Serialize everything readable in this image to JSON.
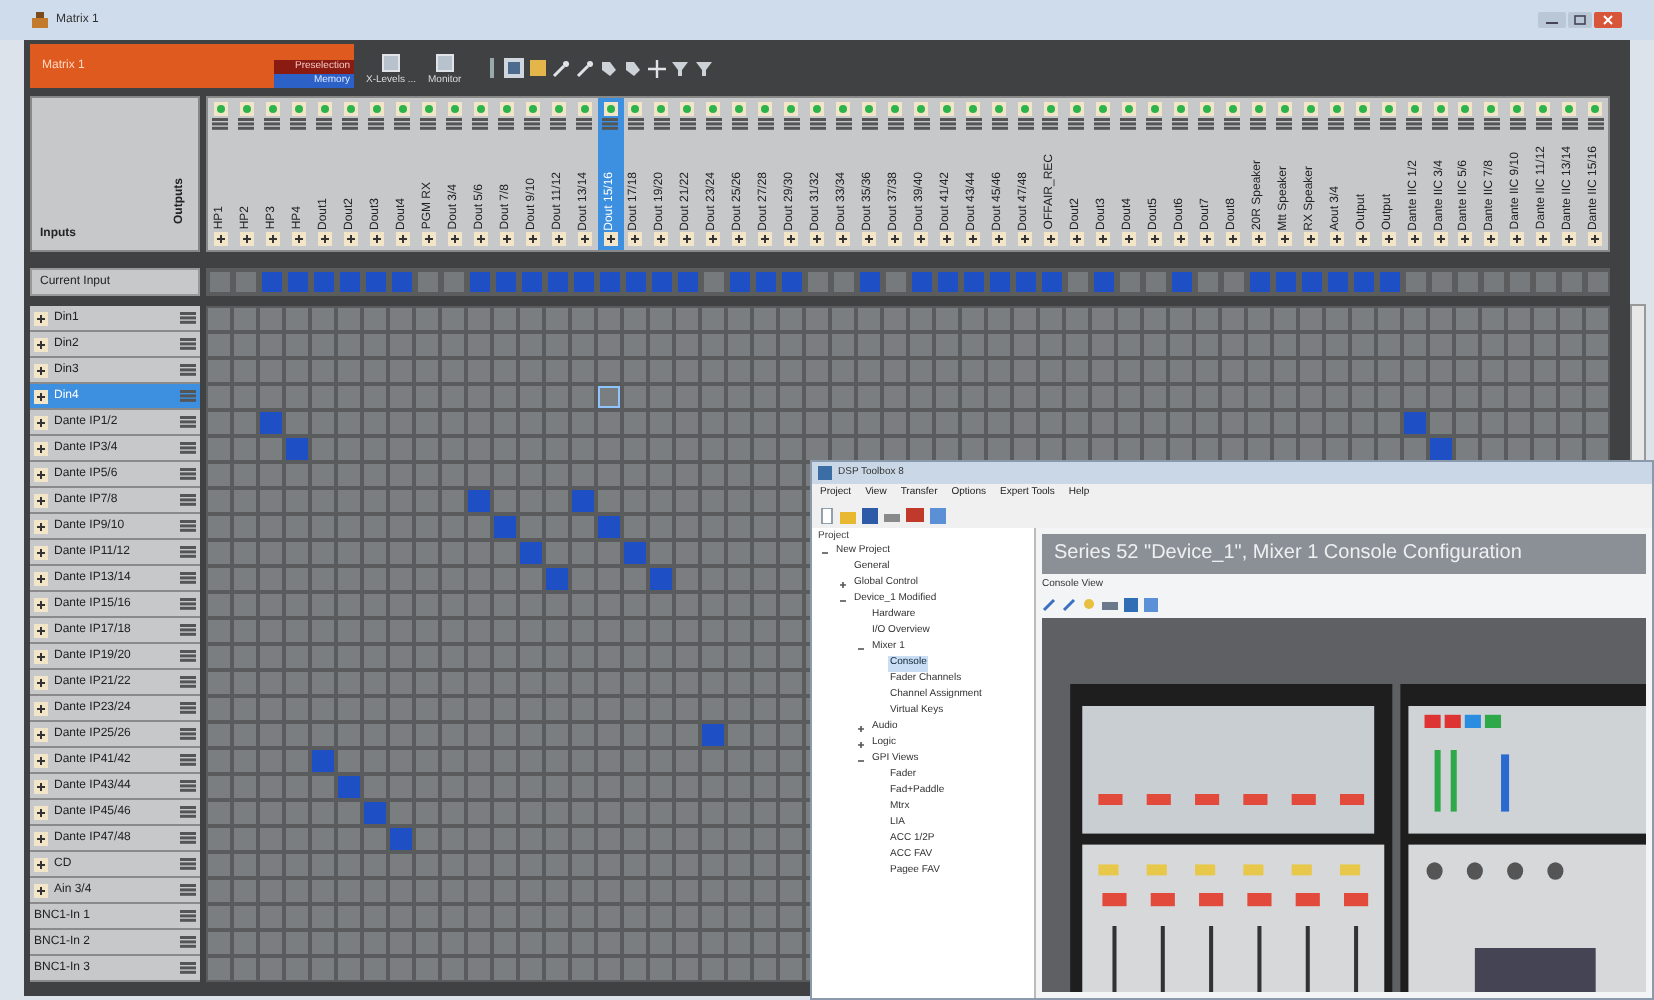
{
  "window": {
    "title": "Matrix 1"
  },
  "header": {
    "name": "Matrix 1",
    "preselection": "Preselection",
    "memory": "Memory",
    "tools": [
      {
        "label": "X-Levels ..."
      },
      {
        "label": "Monitor"
      }
    ]
  },
  "corner": {
    "outputs_label": "Outputs",
    "inputs_label": "Inputs"
  },
  "current_input_label": "Current Input",
  "outputs": [
    {
      "label": "HP1",
      "selected": false,
      "current": false
    },
    {
      "label": "HP2",
      "selected": false,
      "current": false
    },
    {
      "label": "HP3",
      "selected": false,
      "current": true
    },
    {
      "label": "HP4",
      "selected": false,
      "current": true
    },
    {
      "label": "Dout1",
      "selected": false,
      "current": true
    },
    {
      "label": "Dout2",
      "selected": false,
      "current": true
    },
    {
      "label": "Dout3",
      "selected": false,
      "current": true
    },
    {
      "label": "Dout4",
      "selected": false,
      "current": true
    },
    {
      "label": "PGM RX",
      "selected": false,
      "current": false
    },
    {
      "label": "Dout 3/4",
      "selected": false,
      "current": false
    },
    {
      "label": "Dout 5/6",
      "selected": false,
      "current": true
    },
    {
      "label": "Dout 7/8",
      "selected": false,
      "current": true
    },
    {
      "label": "Dout 9/10",
      "selected": false,
      "current": true
    },
    {
      "label": "Dout 11/12",
      "selected": false,
      "current": true
    },
    {
      "label": "Dout 13/14",
      "selected": false,
      "current": true
    },
    {
      "label": "Dout 15/16",
      "selected": true,
      "current": true
    },
    {
      "label": "Dout 17/18",
      "selected": false,
      "current": true
    },
    {
      "label": "Dout 19/20",
      "selected": false,
      "current": true
    },
    {
      "label": "Dout 21/22",
      "selected": false,
      "current": true
    },
    {
      "label": "Dout 23/24",
      "selected": false,
      "current": false
    },
    {
      "label": "Dout 25/26",
      "selected": false,
      "current": true
    },
    {
      "label": "Dout 27/28",
      "selected": false,
      "current": true
    },
    {
      "label": "Dout 29/30",
      "selected": false,
      "current": true
    },
    {
      "label": "Dout 31/32",
      "selected": false,
      "current": false
    },
    {
      "label": "Dout 33/34",
      "selected": false,
      "current": false
    },
    {
      "label": "Dout 35/36",
      "selected": false,
      "current": true
    },
    {
      "label": "Dout 37/38",
      "selected": false,
      "current": false
    },
    {
      "label": "Dout 39/40",
      "selected": false,
      "current": true
    },
    {
      "label": "Dout 41/42",
      "selected": false,
      "current": true
    },
    {
      "label": "Dout 43/44",
      "selected": false,
      "current": true
    },
    {
      "label": "Dout 45/46",
      "selected": false,
      "current": true
    },
    {
      "label": "Dout 47/48",
      "selected": false,
      "current": true
    },
    {
      "label": "OFFAIR_REC",
      "selected": false,
      "current": true
    },
    {
      "label": "Dout2",
      "selected": false,
      "current": false
    },
    {
      "label": "Dout3",
      "selected": false,
      "current": true
    },
    {
      "label": "Dout4",
      "selected": false,
      "current": false
    },
    {
      "label": "Dout5",
      "selected": false,
      "current": false
    },
    {
      "label": "Dout6",
      "selected": false,
      "current": true
    },
    {
      "label": "Dout7",
      "selected": false,
      "current": false
    },
    {
      "label": "Dout8",
      "selected": false,
      "current": false
    },
    {
      "label": "20R Speaker",
      "selected": false,
      "current": true
    },
    {
      "label": "Mtt Speaker",
      "selected": false,
      "current": true
    },
    {
      "label": "RX Speaker",
      "selected": false,
      "current": true
    },
    {
      "label": "Aout 3/4",
      "selected": false,
      "current": true
    },
    {
      "label": "Output",
      "selected": false,
      "current": true
    },
    {
      "label": "Output",
      "selected": false,
      "current": true
    },
    {
      "label": "Dante IIC 1/2",
      "selected": false,
      "current": false
    },
    {
      "label": "Dante IIC 3/4",
      "selected": false,
      "current": false
    },
    {
      "label": "Dante IIC 5/6",
      "selected": false,
      "current": false
    },
    {
      "label": "Dante IIC 7/8",
      "selected": false,
      "current": false
    },
    {
      "label": "Dante IIC 9/10",
      "selected": false,
      "current": false
    },
    {
      "label": "Dante IIC 11/12",
      "selected": false,
      "current": false
    },
    {
      "label": "Dante IIC 13/14",
      "selected": false,
      "current": false
    },
    {
      "label": "Dante IIC 15/16",
      "selected": false,
      "current": false
    }
  ],
  "inputs": [
    {
      "label": "Din1",
      "expandable": true,
      "selected": false,
      "routes": [
        false,
        false,
        false,
        false,
        false,
        false,
        false,
        false,
        false,
        false,
        false,
        false,
        false,
        false,
        false,
        false,
        false,
        false,
        false,
        false,
        false,
        false,
        false,
        false,
        false,
        false,
        false,
        false,
        false,
        false,
        false,
        false,
        false,
        false,
        false,
        false,
        false,
        false,
        false,
        false,
        false,
        false,
        false,
        false,
        false,
        false,
        false,
        false,
        false,
        false,
        false,
        false,
        false,
        false
      ]
    },
    {
      "label": "Din2",
      "expandable": true,
      "selected": false,
      "routes": [
        false,
        false,
        false,
        false,
        false,
        false,
        false,
        false,
        false,
        false,
        false,
        false,
        false,
        false,
        false,
        false,
        false,
        false,
        false,
        false,
        false,
        false,
        false,
        false,
        false,
        false,
        false,
        false,
        false,
        false,
        false,
        false,
        false,
        false,
        false,
        false,
        false,
        false,
        false,
        false,
        false,
        false,
        false,
        false,
        false,
        false,
        false,
        false,
        false,
        false,
        false,
        false,
        false,
        false
      ]
    },
    {
      "label": "Din3",
      "expandable": true,
      "selected": false,
      "routes": [
        false,
        false,
        false,
        false,
        false,
        false,
        false,
        false,
        false,
        false,
        false,
        false,
        false,
        false,
        false,
        false,
        false,
        false,
        false,
        false,
        false,
        false,
        false,
        false,
        false,
        false,
        false,
        false,
        false,
        false,
        false,
        false,
        false,
        false,
        false,
        false,
        false,
        false,
        false,
        false,
        false,
        false,
        false,
        false,
        false,
        false,
        false,
        false,
        false,
        false,
        false,
        false,
        false,
        false
      ]
    },
    {
      "label": "Din4",
      "expandable": true,
      "selected": true,
      "routes": [
        false,
        false,
        false,
        false,
        false,
        false,
        false,
        false,
        false,
        false,
        false,
        false,
        false,
        false,
        false,
        false,
        false,
        false,
        false,
        false,
        false,
        false,
        false,
        false,
        false,
        false,
        false,
        false,
        false,
        false,
        false,
        false,
        false,
        false,
        false,
        false,
        false,
        false,
        false,
        false,
        false,
        false,
        false,
        false,
        false,
        false,
        false,
        false,
        false,
        false,
        false,
        false,
        false,
        false
      ]
    },
    {
      "label": "Dante IP1/2",
      "expandable": true,
      "selected": false,
      "routes": [
        false,
        false,
        true,
        false,
        false,
        false,
        false,
        false,
        false,
        false,
        false,
        false,
        false,
        false,
        false,
        false,
        false,
        false,
        false,
        false,
        false,
        false,
        false,
        false,
        false,
        false,
        false,
        false,
        false,
        false,
        false,
        false,
        false,
        false,
        false,
        false,
        false,
        false,
        false,
        false,
        false,
        false,
        false,
        false,
        false,
        false,
        true,
        false,
        false,
        false,
        false,
        false,
        false,
        false
      ]
    },
    {
      "label": "Dante IP3/4",
      "expandable": true,
      "selected": false,
      "routes": [
        false,
        false,
        false,
        true,
        false,
        false,
        false,
        false,
        false,
        false,
        false,
        false,
        false,
        false,
        false,
        false,
        false,
        false,
        false,
        false,
        false,
        false,
        false,
        false,
        false,
        false,
        false,
        false,
        false,
        false,
        false,
        false,
        false,
        false,
        false,
        false,
        false,
        false,
        false,
        false,
        false,
        false,
        false,
        false,
        false,
        false,
        false,
        true,
        false,
        false,
        false,
        false,
        false,
        false
      ]
    },
    {
      "label": "Dante IP5/6",
      "expandable": true,
      "selected": false,
      "routes": [
        false,
        false,
        false,
        false,
        false,
        false,
        false,
        false,
        false,
        false,
        false,
        false,
        false,
        false,
        false,
        false,
        false,
        false,
        false,
        false,
        false,
        false,
        false
      ]
    },
    {
      "label": "Dante IP7/8",
      "expandable": true,
      "selected": false,
      "routes": [
        false,
        false,
        false,
        false,
        false,
        false,
        false,
        false,
        false,
        false,
        true,
        false,
        false,
        false,
        true,
        false,
        false,
        false,
        false,
        false,
        false,
        false,
        false
      ]
    },
    {
      "label": "Dante IP9/10",
      "expandable": true,
      "selected": false,
      "routes": [
        false,
        false,
        false,
        false,
        false,
        false,
        false,
        false,
        false,
        false,
        false,
        true,
        false,
        false,
        false,
        true,
        false,
        false,
        false,
        false,
        false,
        false,
        false
      ]
    },
    {
      "label": "Dante IP11/12",
      "expandable": true,
      "selected": false,
      "routes": [
        false,
        false,
        false,
        false,
        false,
        false,
        false,
        false,
        false,
        false,
        false,
        false,
        true,
        false,
        false,
        false,
        true,
        false,
        false,
        false,
        false,
        false,
        false
      ]
    },
    {
      "label": "Dante IP13/14",
      "expandable": true,
      "selected": false,
      "routes": [
        false,
        false,
        false,
        false,
        false,
        false,
        false,
        false,
        false,
        false,
        false,
        false,
        false,
        true,
        false,
        false,
        false,
        true,
        false,
        false,
        false,
        false,
        false
      ]
    },
    {
      "label": "Dante IP15/16",
      "expandable": true,
      "selected": false,
      "routes": [
        false,
        false,
        false,
        false,
        false,
        false,
        false,
        false,
        false,
        false,
        false,
        false,
        false,
        false,
        false,
        false,
        false,
        false,
        false,
        false,
        false,
        false,
        false
      ]
    },
    {
      "label": "Dante IP17/18",
      "expandable": true,
      "selected": false,
      "routes": [
        false,
        false,
        false,
        false,
        false,
        false,
        false,
        false,
        false,
        false,
        false,
        false,
        false,
        false,
        false,
        false,
        false,
        false,
        false,
        false,
        false,
        false,
        false
      ]
    },
    {
      "label": "Dante IP19/20",
      "expandable": true,
      "selected": false,
      "routes": [
        false,
        false,
        false,
        false,
        false,
        false,
        false,
        false,
        false,
        false,
        false,
        false,
        false,
        false,
        false,
        false,
        false,
        false,
        false,
        false,
        false,
        false,
        false
      ]
    },
    {
      "label": "Dante IP21/22",
      "expandable": true,
      "selected": false,
      "routes": [
        false,
        false,
        false,
        false,
        false,
        false,
        false,
        false,
        false,
        false,
        false,
        false,
        false,
        false,
        false,
        false,
        false,
        false,
        false,
        false,
        false,
        false,
        false
      ]
    },
    {
      "label": "Dante IP23/24",
      "expandable": true,
      "selected": false,
      "routes": [
        false,
        false,
        false,
        false,
        false,
        false,
        false,
        false,
        false,
        false,
        false,
        false,
        false,
        false,
        false,
        false,
        false,
        false,
        false,
        false,
        false,
        false,
        false
      ]
    },
    {
      "label": "Dante IP25/26",
      "expandable": true,
      "selected": false,
      "routes": [
        false,
        false,
        false,
        false,
        false,
        false,
        false,
        false,
        false,
        false,
        false,
        false,
        false,
        false,
        false,
        false,
        false,
        false,
        false,
        true,
        false,
        false,
        false
      ]
    },
    {
      "label": "Dante IP41/42",
      "expandable": true,
      "selected": false,
      "routes": [
        false,
        false,
        false,
        false,
        true,
        false,
        false,
        false,
        false,
        false,
        false,
        false,
        false,
        false,
        false,
        false,
        false,
        false,
        false,
        false,
        false,
        false,
        false
      ]
    },
    {
      "label": "Dante IP43/44",
      "expandable": true,
      "selected": false,
      "routes": [
        false,
        false,
        false,
        false,
        false,
        true,
        false,
        false,
        false,
        false,
        false,
        false,
        false,
        false,
        false,
        false,
        false,
        false,
        false,
        false,
        false,
        false,
        false
      ]
    },
    {
      "label": "Dante IP45/46",
      "expandable": true,
      "selected": false,
      "routes": [
        false,
        false,
        false,
        false,
        false,
        false,
        true,
        false,
        false,
        false,
        false,
        false,
        false,
        false,
        false,
        false,
        false,
        false,
        false,
        false,
        false,
        false,
        false
      ]
    },
    {
      "label": "Dante IP47/48",
      "expandable": true,
      "selected": false,
      "routes": [
        false,
        false,
        false,
        false,
        false,
        false,
        false,
        true,
        false,
        false,
        false,
        false,
        false,
        false,
        false,
        false,
        false,
        false,
        false,
        false,
        false,
        false,
        false
      ]
    },
    {
      "label": "CD",
      "expandable": true,
      "selected": false,
      "routes": [
        false,
        false,
        false,
        false,
        false,
        false,
        false,
        false,
        false,
        false,
        false,
        false,
        false,
        false,
        false,
        false,
        false,
        false,
        false,
        false,
        false,
        false,
        false
      ]
    },
    {
      "label": "Ain 3/4",
      "expandable": true,
      "selected": false,
      "routes": [
        false,
        false,
        false,
        false,
        false,
        false,
        false,
        false,
        false,
        false,
        false,
        false,
        false,
        false,
        false,
        false,
        false,
        false,
        false,
        false,
        false,
        false,
        false
      ]
    },
    {
      "label": "BNC1-In 1",
      "expandable": false,
      "selected": false,
      "routes": [
        false,
        false,
        false,
        false,
        false,
        false,
        false,
        false,
        false,
        false,
        false,
        false,
        false,
        false,
        false,
        false,
        false,
        false,
        false,
        false,
        false,
        false,
        false
      ]
    },
    {
      "label": "BNC1-In 2",
      "expandable": false,
      "selected": false,
      "routes": [
        false,
        false,
        false,
        false,
        false,
        false,
        false,
        false,
        false,
        false,
        false,
        false,
        false,
        false,
        false,
        false,
        false,
        false,
        false,
        false,
        false,
        false,
        false
      ]
    },
    {
      "label": "BNC1-In 3",
      "expandable": false,
      "selected": false,
      "routes": [
        false,
        false,
        false,
        false,
        false,
        false,
        false,
        false,
        false,
        false,
        false,
        false,
        false,
        false,
        false,
        false,
        false,
        false,
        false,
        false,
        false,
        false,
        false
      ]
    }
  ],
  "toolbox": {
    "title": "DSP Toolbox 8",
    "menu": [
      "Project",
      "View",
      "Transfer",
      "Options",
      "Expert Tools",
      "Help"
    ],
    "project_label": "Project",
    "tree": [
      {
        "label": "New Project",
        "expanded": true,
        "selected": false,
        "children": [
          {
            "label": "General",
            "selected": false
          },
          {
            "label": "Global Control",
            "expanded": false,
            "selected": false
          },
          {
            "label": "Device_1 Modified",
            "expanded": true,
            "selected": false,
            "children": [
              {
                "label": "Hardware",
                "selected": false
              },
              {
                "label": "I/O Overview",
                "selected": false
              },
              {
                "label": "Mixer 1",
                "expanded": true,
                "selected": false,
                "children": [
                  {
                    "label": "Console",
                    "selected": true
                  },
                  {
                    "label": "Fader Channels",
                    "selected": false
                  },
                  {
                    "label": "Channel Assignment",
                    "selected": false
                  },
                  {
                    "label": "Virtual Keys",
                    "selected": false
                  }
                ]
              },
              {
                "label": "Audio",
                "expanded": false,
                "selected": false
              },
              {
                "label": "Logic",
                "expanded": false,
                "selected": false
              },
              {
                "label": "GPI Views",
                "expanded": true,
                "selected": false,
                "children": [
                  {
                    "label": "Fader",
                    "selected": false
                  },
                  {
                    "label": "Fad+Paddle",
                    "selected": false
                  },
                  {
                    "label": "Mtrx",
                    "selected": false
                  },
                  {
                    "label": "LIA",
                    "selected": false
                  },
                  {
                    "label": "ACC 1/2P",
                    "selected": false
                  },
                  {
                    "label": "ACC FAV",
                    "selected": false
                  },
                  {
                    "label": "Pagee FAV",
                    "selected": false
                  }
                ]
              }
            ]
          }
        ]
      }
    ],
    "panel_title": "Series 52 \"Device_1\", Mixer 1 Console Configuration",
    "view_label": "Console View"
  }
}
